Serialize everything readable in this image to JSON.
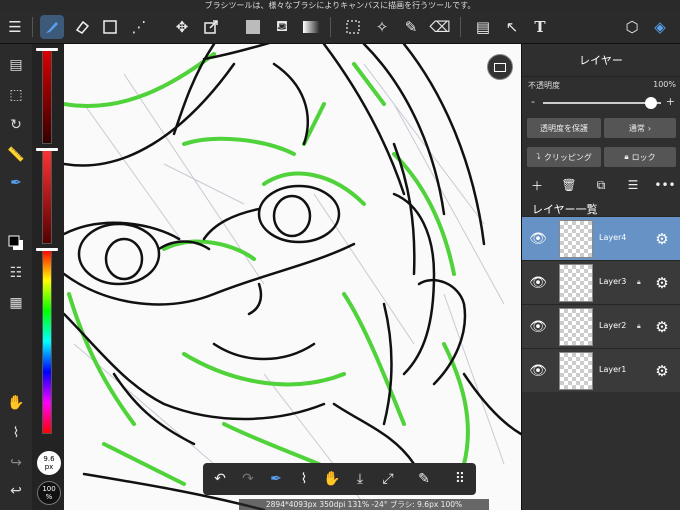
{
  "tip_text": "ブラシツールは、様々なブラシによりキャンバスに描画を行うツールです。",
  "toolbar": {
    "menu_icon": "hamburger-icon",
    "text_tool_glyph": "T"
  },
  "left_tools": {
    "brush_size_value": "9.6",
    "brush_size_unit": "px",
    "opacity_value": "100",
    "opacity_unit": "%"
  },
  "canvas": {
    "status_text": "2894*4093px 350dpi 131% -24° ブラシ: 9.6px 100%"
  },
  "layer_panel": {
    "title": "レイヤー",
    "opacity_label": "不透明度",
    "opacity_value": "100%",
    "protect_alpha_label": "透明度を保護",
    "blend_mode_label": "通常",
    "clipping_label": "クリッピング",
    "lock_label": "ロック",
    "list_header": "レイヤー一覧",
    "layers": [
      {
        "name": "Layer4",
        "selected": true,
        "locked": false
      },
      {
        "name": "Layer3",
        "selected": false,
        "locked": true
      },
      {
        "name": "Layer2",
        "selected": false,
        "locked": true
      },
      {
        "name": "Layer1",
        "selected": false,
        "locked": false
      }
    ]
  },
  "colors": {
    "accent": "#6792c6",
    "line_green": "#4fd23a",
    "panel_bg": "#2f2f2f"
  }
}
